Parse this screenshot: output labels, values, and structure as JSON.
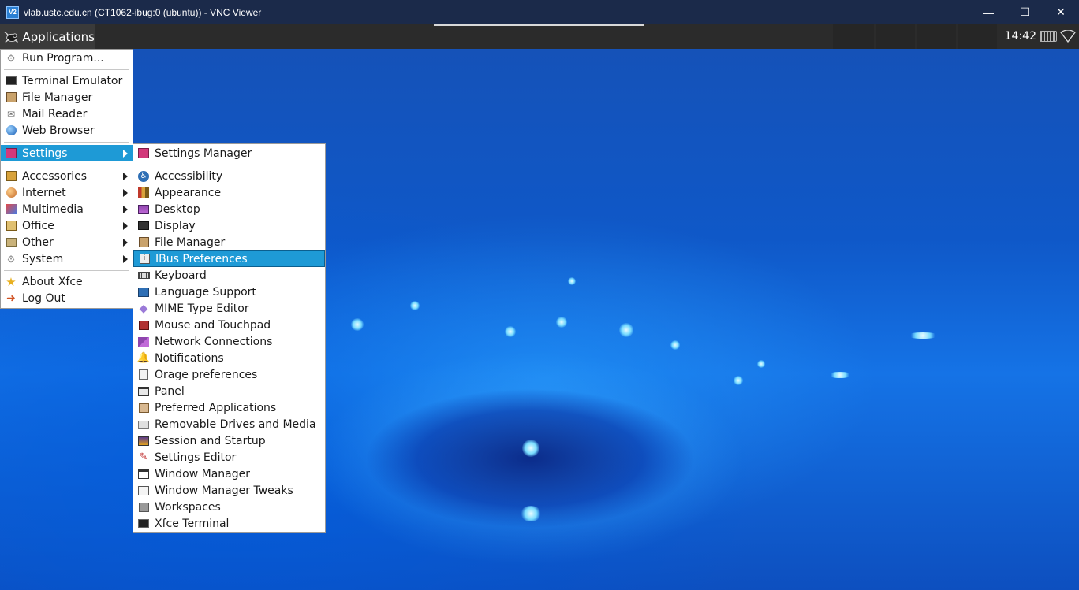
{
  "window": {
    "title": "vlab.ustc.edu.cn (CT1062-ibug:0 (ubuntu)) - VNC Viewer",
    "app_icon_text": "V2",
    "controls": {
      "minimize": "—",
      "maximize": "☐",
      "close": "✕"
    }
  },
  "panel": {
    "applications_label": "Applications",
    "clock": "14:42"
  },
  "main_menu": {
    "run_program": "Run Program...",
    "terminal_emulator": "Terminal Emulator",
    "file_manager": "File Manager",
    "mail_reader": "Mail Reader",
    "web_browser": "Web Browser",
    "settings": "Settings",
    "accessories": "Accessories",
    "internet": "Internet",
    "multimedia": "Multimedia",
    "office": "Office",
    "other": "Other",
    "system": "System",
    "about_xfce": "About Xfce",
    "log_out": "Log Out"
  },
  "settings_menu": {
    "settings_manager": "Settings Manager",
    "items": [
      "Accessibility",
      "Appearance",
      "Desktop",
      "Display",
      "File Manager",
      "IBus Preferences",
      "Keyboard",
      "Language Support",
      "MIME Type Editor",
      "Mouse and Touchpad",
      "Network Connections",
      "Notifications",
      "Orage preferences",
      "Panel",
      "Preferred Applications",
      "Removable Drives and Media",
      "Session and Startup",
      "Settings Editor",
      "Window Manager",
      "Window Manager Tweaks",
      "Workspaces",
      "Xfce Terminal"
    ],
    "highlighted": "IBus Preferences"
  },
  "colors": {
    "selection": "#1e9ad6",
    "panel": "#2b2b2b",
    "titlebar": "#1b2a4a"
  }
}
